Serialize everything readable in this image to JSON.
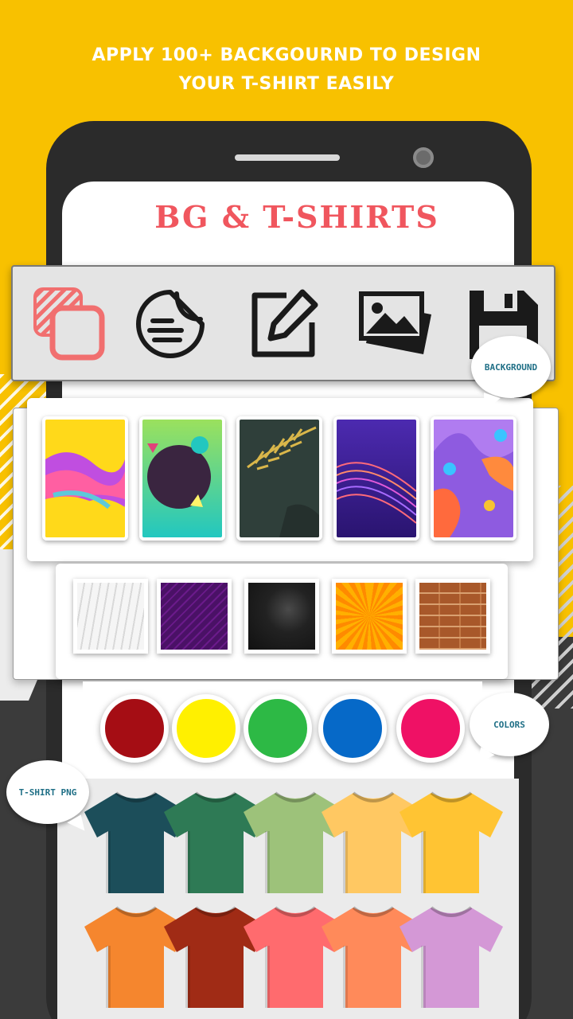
{
  "headline": {
    "line1": "APPLY 100+ BACKGOURND TO DESIGN",
    "line2": "YOUR T-SHIRT EASILY"
  },
  "screen": {
    "title": "BG & T-SHIRTS"
  },
  "toolbar": {
    "tools": [
      {
        "icon": "layers-icon",
        "color": "#f16f6f"
      },
      {
        "icon": "sticker-icon",
        "color": "#1a1a1a"
      },
      {
        "icon": "edit-icon",
        "color": "#1a1a1a"
      },
      {
        "icon": "gallery-icon",
        "color": "#1a1a1a"
      },
      {
        "icon": "save-icon",
        "color": "#1a1a1a"
      }
    ]
  },
  "bubbles": {
    "background": "BACKGROUND",
    "colors": "COLORS",
    "tshirt": "T-SHIRT PNG"
  },
  "backgrounds": [
    {
      "name": "yellow-purple-wave",
      "colors": [
        "#ffd91a",
        "#b24ad8",
        "#ff5fa2"
      ]
    },
    {
      "name": "green-circle",
      "colors": [
        "#9be15d",
        "#3a2540",
        "#2ad0c2"
      ]
    },
    {
      "name": "dark-leaf",
      "colors": [
        "#2f3f3a",
        "#1f2b28",
        "#d9b64a"
      ]
    },
    {
      "name": "purple-mesh",
      "colors": [
        "#3a1e8c",
        "#6b2bc7",
        "#ff6a7a"
      ]
    },
    {
      "name": "fluid-purple",
      "colors": [
        "#8e5be0",
        "#ff8a3d",
        "#39c4ff"
      ]
    }
  ],
  "textures": [
    {
      "name": "white-curves",
      "color": "#e9e9e9"
    },
    {
      "name": "purple-lines",
      "color": "#4a1166"
    },
    {
      "name": "black-grunge",
      "color": "#222222"
    },
    {
      "name": "orange-burst",
      "color": "#ff9f10"
    },
    {
      "name": "brick-wall",
      "color": "#c37845"
    }
  ],
  "colors": [
    "#a50d14",
    "#fff000",
    "#2db945",
    "#0669c8",
    "#ef1165"
  ],
  "tshirts": [
    "#1c4e5a",
    "#2e7a55",
    "#9dc27a",
    "#ffc862",
    "#ffc433",
    "#f5862e",
    "#a02b15",
    "#ff6b6e",
    "#ff8a5a",
    "#d498d6"
  ]
}
